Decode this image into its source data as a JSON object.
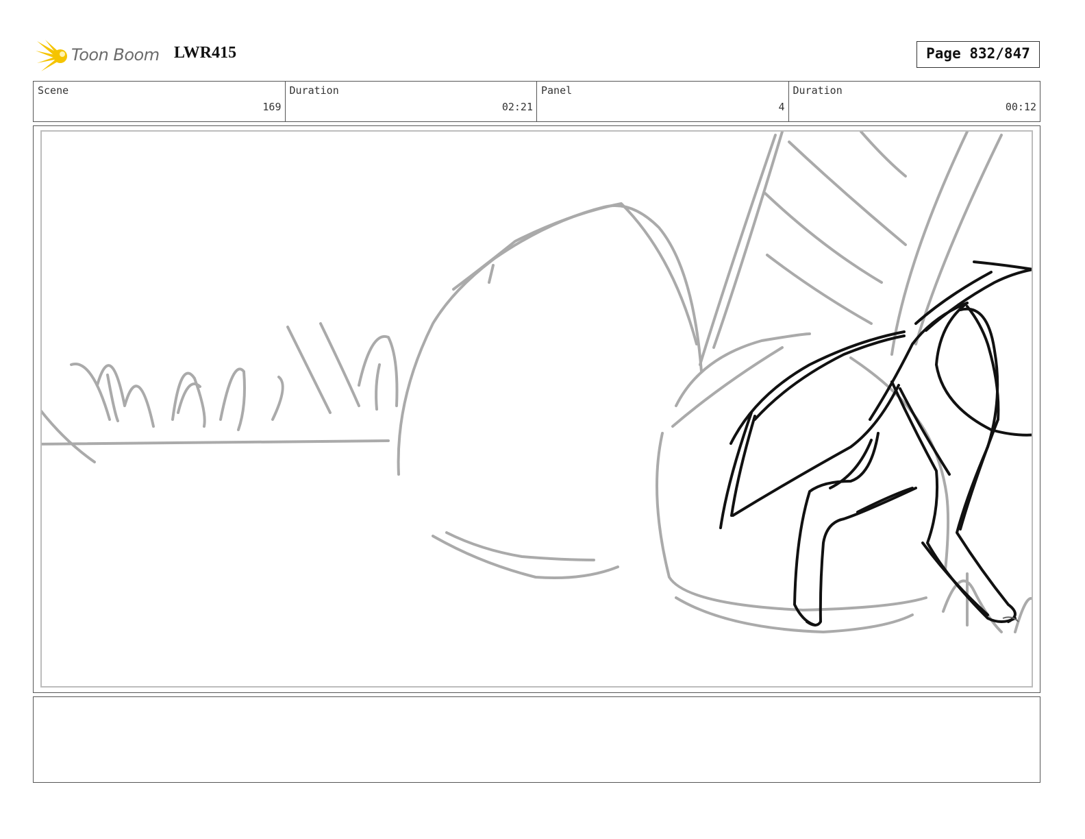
{
  "header": {
    "logo_text": "Toon Boom",
    "project_code": "LWR415",
    "page_label": "Page 832/847"
  },
  "info": {
    "scene_label": "Scene",
    "scene_value": "169",
    "scene_duration_label": "Duration",
    "scene_duration_value": "02:21",
    "panel_label": "Panel",
    "panel_value": "4",
    "panel_duration_label": "Duration",
    "panel_duration_value": "00:12"
  },
  "colors": {
    "logo_yellow": "#f5c400",
    "sketch_gray": "#aaaaaa",
    "sketch_black": "#111111"
  },
  "notes": {
    "text": ""
  }
}
